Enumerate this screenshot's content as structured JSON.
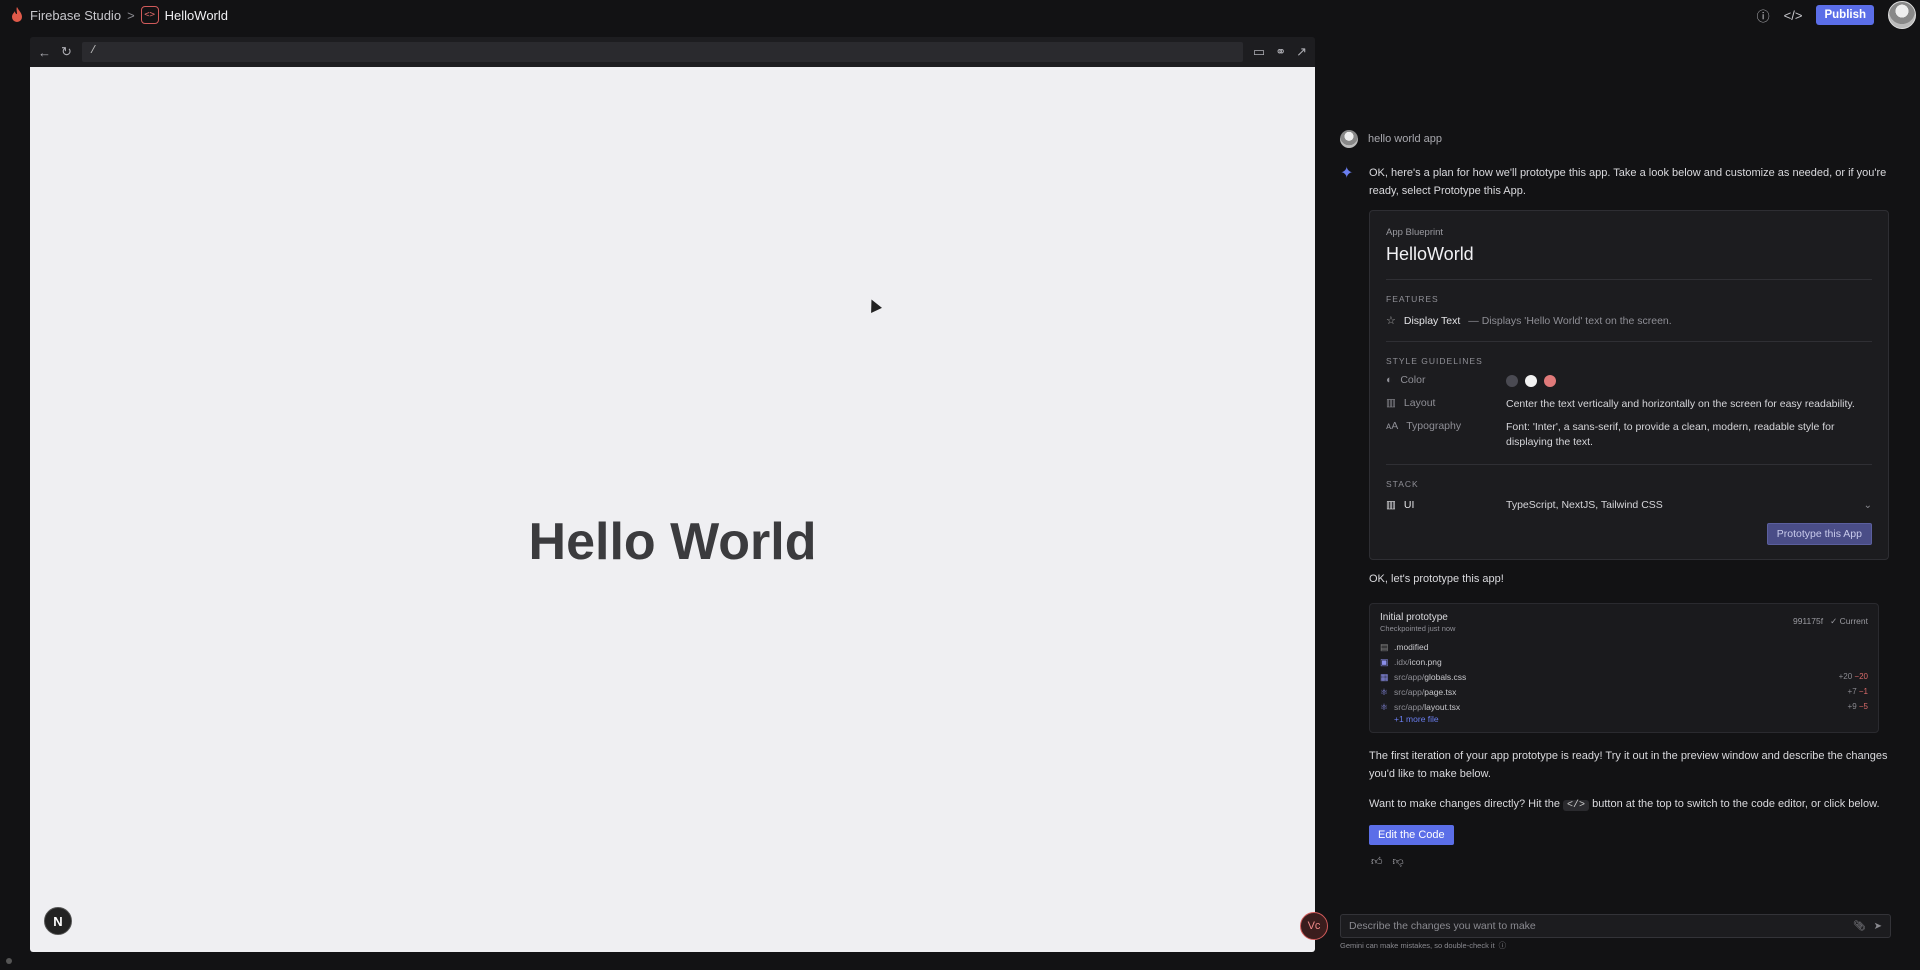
{
  "topbar": {
    "app_name": "Firebase Studio",
    "separator": ">",
    "project_name": "HelloWorld",
    "publish_label": "Publish",
    "help_icon": "?",
    "code_icon": "</>"
  },
  "preview": {
    "url": "/",
    "heading": "Hello World",
    "next_badge": "N"
  },
  "chat": {
    "user_message": "hello world app",
    "ai_intro": "OK, here's a plan for how we'll prototype this app. Take a look below and customize as needed, or if you're ready, select Prototype this App.",
    "blueprint": {
      "label": "App Blueprint",
      "title": "HelloWorld",
      "features_heading": "FEATURES",
      "feature_name": "Display Text",
      "feature_desc": "— Displays 'Hello World' text on the screen.",
      "style_heading": "STYLE GUIDELINES",
      "color_key": "Color",
      "layout_key": "Layout",
      "layout_val": "Center the text vertically and horizontally on the screen for easy readability.",
      "typography_key": "Typography",
      "typography_val": "Font: 'Inter', a sans-serif, to provide a clean, modern, readable style for displaying the text.",
      "swatches": [
        "#4a4a52",
        "#f2f2f2",
        "#e07a7a"
      ],
      "stack_heading": "STACK",
      "stack_key": "UI",
      "stack_val": "TypeScript, NextJS, Tailwind CSS",
      "prototype_button": "Prototype this App"
    },
    "ai_followup": "OK, let's prototype this app!",
    "checkpoint": {
      "title": "Initial prototype",
      "subtitle": "Checkpointed just now",
      "hash": "991175f",
      "status": "✓ Current",
      "files": [
        {
          "dir": "",
          "name": ".modified",
          "plus": "",
          "minus": ""
        },
        {
          "dir": ".idx/",
          "name": "icon.png",
          "plus": "",
          "minus": ""
        },
        {
          "dir": "src/app/",
          "name": "globals.css",
          "plus": "+20",
          "minus": "−20"
        },
        {
          "dir": "src/app/",
          "name": "page.tsx",
          "plus": "+7",
          "minus": "−1"
        },
        {
          "dir": "src/app/",
          "name": "layout.tsx",
          "plus": "+9",
          "minus": "−5"
        }
      ],
      "more": "+1 more file"
    },
    "ready_text": "The first iteration of your app prototype is ready! Try it out in the preview window and describe the changes you'd like to make below.",
    "edit_prefix": "Want to make changes directly? Hit the",
    "edit_chip": "</>",
    "edit_suffix": "button at the top to switch to the code editor, or click below.",
    "edit_button": "Edit the Code",
    "input_placeholder": "Describe the changes you want to make",
    "disclaimer": "Gemini can make mistakes, so double-check it"
  }
}
